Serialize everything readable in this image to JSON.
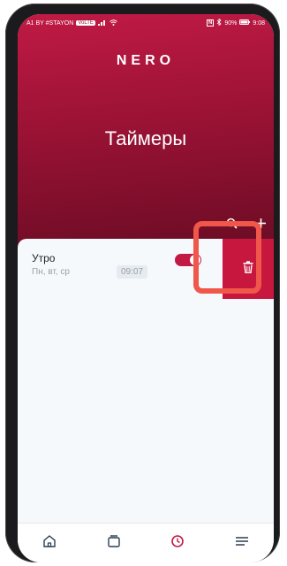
{
  "status_bar": {
    "carrier": "A1 BY #STAYON",
    "carrier_badge": "VoLTE",
    "nfc": "N",
    "battery": "90%",
    "time": "9:08"
  },
  "app": {
    "brand": "NERO",
    "title": "Таймеры"
  },
  "timers": [
    {
      "name": "Утро",
      "days": "Пн, вт, ср",
      "time": "09:07",
      "enabled": true
    }
  ],
  "colors": {
    "accent": "#c01a45",
    "delete_bg": "#c8173f",
    "highlight": "#f0574a",
    "nav_active": "#c01a45",
    "nav_inactive": "#2c3e50"
  },
  "icons": {
    "search": "search-icon",
    "add": "plus-icon",
    "delete": "trash-icon",
    "home": "home-icon",
    "devices": "devices-icon",
    "timers": "clock-icon",
    "menu": "menu-icon"
  }
}
